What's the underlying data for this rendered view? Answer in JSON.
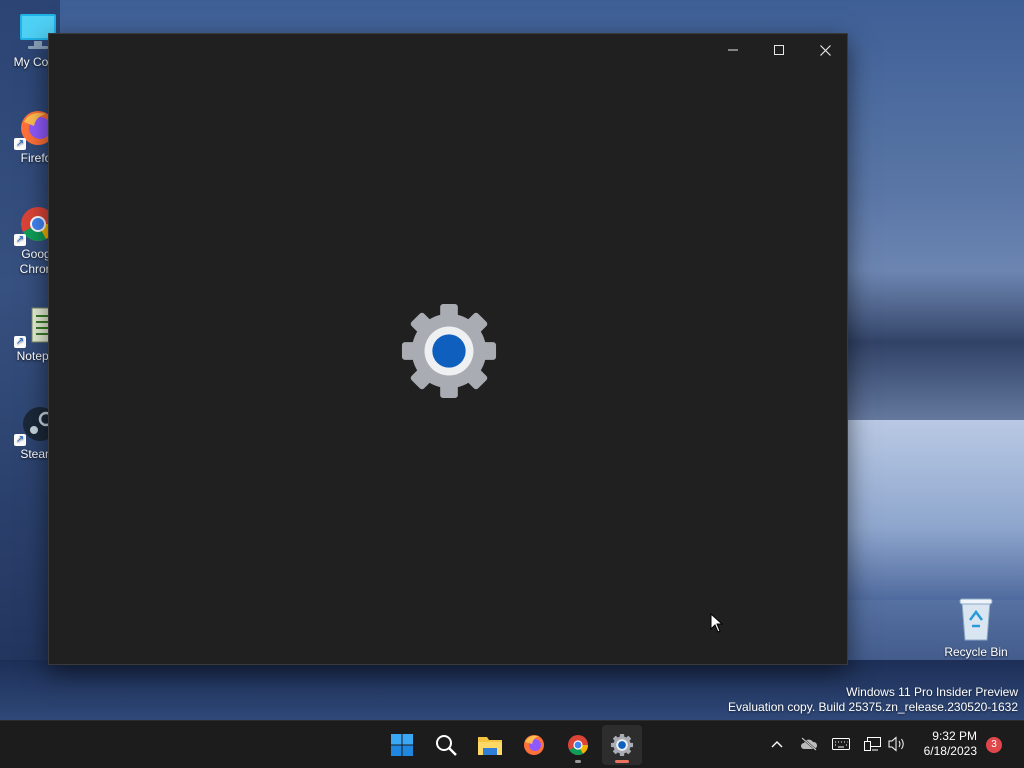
{
  "desktop": {
    "icons": [
      {
        "label": "My Com",
        "icon": "computer-icon"
      },
      {
        "label": "Firefo",
        "icon": "firefox-icon"
      },
      {
        "label": "Goog Chron",
        "icon": "chrome-icon"
      },
      {
        "label": "Notepa",
        "icon": "notepad-icon"
      },
      {
        "label": "Stean",
        "icon": "steam-icon"
      }
    ],
    "recycle_bin": {
      "label": "Recycle Bin",
      "icon": "recycle-bin-icon"
    }
  },
  "window": {
    "splash_icon": "settings-gear-icon",
    "controls": [
      "minimize",
      "maximize",
      "close"
    ]
  },
  "watermark": {
    "line1": "Windows 11 Pro Insider Preview",
    "line2": "Evaluation copy. Build 25375.zn_release.230520-1632"
  },
  "taskbar": {
    "apps": [
      "start-icon",
      "search-icon",
      "file-explorer-icon",
      "firefox-icon",
      "chrome-icon",
      "settings-icon"
    ],
    "tray": {
      "time": "9:32 PM",
      "date": "6/18/2023",
      "notifications": "3"
    }
  },
  "colors": {
    "window_bg": "#202020",
    "taskbar_bg": "#1c1c1c",
    "accent": "#0f5fbf",
    "notification_badge": "#e0474a"
  }
}
